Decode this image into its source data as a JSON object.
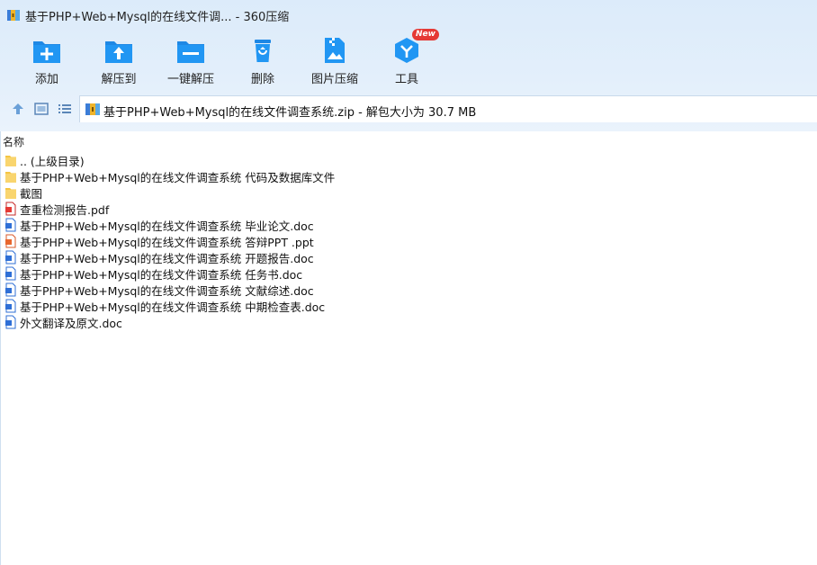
{
  "window": {
    "title": "基于PHP+Web+Mysql的在线文件调... - 360压缩"
  },
  "toolbar": {
    "items": [
      {
        "label": "添加",
        "icon": "add-icon"
      },
      {
        "label": "解压到",
        "icon": "extract-to-icon"
      },
      {
        "label": "一键解压",
        "icon": "one-click-extract-icon"
      },
      {
        "label": "删除",
        "icon": "delete-icon"
      },
      {
        "label": "图片压缩",
        "icon": "image-compress-icon"
      },
      {
        "label": "工具",
        "icon": "tools-icon",
        "badge": "New"
      }
    ]
  },
  "path": {
    "text": "基于PHP+Web+Mysql的在线文件调查系统.zip - 解包大小为 30.7 MB"
  },
  "list": {
    "header": "名称",
    "files": [
      {
        "name": ".. (上级目录)",
        "type": "folder"
      },
      {
        "name": "基于PHP+Web+Mysql的在线文件调查系统 代码及数据库文件",
        "type": "folder"
      },
      {
        "name": "截图",
        "type": "folder"
      },
      {
        "name": "查重检测报告.pdf",
        "type": "pdf"
      },
      {
        "name": "基于PHP+Web+Mysql的在线文件调查系统 毕业论文.doc",
        "type": "doc"
      },
      {
        "name": "基于PHP+Web+Mysql的在线文件调查系统 答辩PPT .ppt",
        "type": "ppt"
      },
      {
        "name": "基于PHP+Web+Mysql的在线文件调查系统 开题报告.doc",
        "type": "doc"
      },
      {
        "name": "基于PHP+Web+Mysql的在线文件调查系统 任务书.doc",
        "type": "doc"
      },
      {
        "name": "基于PHP+Web+Mysql的在线文件调查系统 文献综述.doc",
        "type": "doc"
      },
      {
        "name": "基于PHP+Web+Mysql的在线文件调查系统 中期检查表.doc",
        "type": "doc"
      },
      {
        "name": "外文翻译及原文.doc",
        "type": "doc"
      }
    ]
  },
  "colors": {
    "accent": "#1e88e5",
    "folder": "#f5c542",
    "pdf": "#e53935",
    "ppt": "#e8672e",
    "doc": "#2f6fd6"
  }
}
